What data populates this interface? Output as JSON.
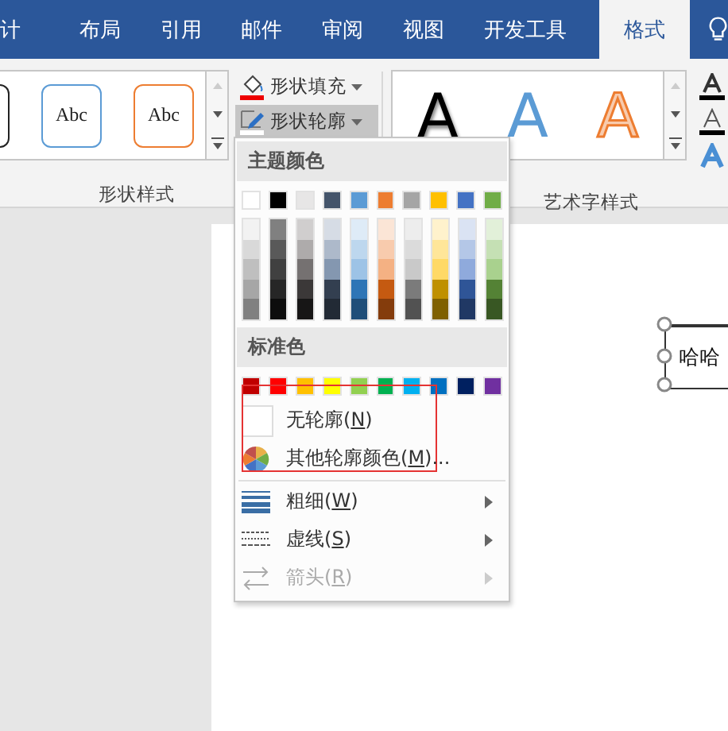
{
  "tabs": [
    {
      "label": "计",
      "selected": false
    },
    {
      "label": "布局",
      "selected": false
    },
    {
      "label": "引用",
      "selected": false
    },
    {
      "label": "邮件",
      "selected": false
    },
    {
      "label": "审阅",
      "selected": false
    },
    {
      "label": "视图",
      "selected": false
    },
    {
      "label": "开发工具",
      "selected": false
    },
    {
      "label": "格式",
      "selected": true
    }
  ],
  "shape_styles": {
    "thumbnails": [
      {
        "kind": "black"
      },
      {
        "kind": "blue",
        "text": "Abc"
      },
      {
        "kind": "orange",
        "text": "Abc"
      }
    ],
    "buttons": [
      {
        "kind": "fill",
        "label": "形状填充",
        "selected": false
      },
      {
        "kind": "outline",
        "label": "形状轮廓",
        "selected": true
      }
    ],
    "group_label": "形状样式"
  },
  "wordart_styles": {
    "letters": [
      {
        "kind": "black",
        "text": "A"
      },
      {
        "kind": "blue",
        "text": "A"
      },
      {
        "kind": "orange",
        "text": "A"
      }
    ],
    "group_label": "艺术字样式"
  },
  "outline_menu": {
    "theme_header": "主题颜色",
    "theme_colors": [
      {
        "color": "#ffffff"
      },
      {
        "color": "#000000"
      },
      {
        "color": "#e7e6e6"
      },
      {
        "color": "#44546a"
      },
      {
        "color": "#5b9bd5"
      },
      {
        "color": "#ed7d31"
      },
      {
        "color": "#a5a5a5"
      },
      {
        "color": "#ffc000"
      },
      {
        "color": "#4472c4"
      },
      {
        "color": "#70ad47"
      }
    ],
    "shades": [
      {
        "colors": [
          {
            "color": "#f2f2f2"
          },
          {
            "color": "#d9d9d9"
          },
          {
            "color": "#bfbfbf"
          },
          {
            "color": "#a6a6a6"
          },
          {
            "color": "#808080"
          }
        ]
      },
      {
        "colors": [
          {
            "color": "#808080"
          },
          {
            "color": "#595959"
          },
          {
            "color": "#404040"
          },
          {
            "color": "#262626"
          },
          {
            "color": "#0d0d0d"
          }
        ]
      },
      {
        "colors": [
          {
            "color": "#d0cece"
          },
          {
            "color": "#aeabab"
          },
          {
            "color": "#757171"
          },
          {
            "color": "#3b3838"
          },
          {
            "color": "#171616"
          }
        ]
      },
      {
        "colors": [
          {
            "color": "#d6dce5"
          },
          {
            "color": "#adb9ca"
          },
          {
            "color": "#8497b0"
          },
          {
            "color": "#333f50"
          },
          {
            "color": "#222a35"
          }
        ]
      },
      {
        "colors": [
          {
            "color": "#deebf7"
          },
          {
            "color": "#bdd7ee"
          },
          {
            "color": "#9dc3e6"
          },
          {
            "color": "#2e75b6"
          },
          {
            "color": "#1f4e79"
          }
        ]
      },
      {
        "colors": [
          {
            "color": "#fbe5d6"
          },
          {
            "color": "#f8cbad"
          },
          {
            "color": "#f4b183"
          },
          {
            "color": "#c55a11"
          },
          {
            "color": "#843c0c"
          }
        ]
      },
      {
        "colors": [
          {
            "color": "#ededed"
          },
          {
            "color": "#dbdbdb"
          },
          {
            "color": "#c9c9c9"
          },
          {
            "color": "#7b7b7b"
          },
          {
            "color": "#525252"
          }
        ]
      },
      {
        "colors": [
          {
            "color": "#fff2cc"
          },
          {
            "color": "#ffe699"
          },
          {
            "color": "#ffd966"
          },
          {
            "color": "#bf9000"
          },
          {
            "color": "#7f6000"
          }
        ]
      },
      {
        "colors": [
          {
            "color": "#dae3f3"
          },
          {
            "color": "#b4c7e7"
          },
          {
            "color": "#8faadc"
          },
          {
            "color": "#2f5597"
          },
          {
            "color": "#203864"
          }
        ]
      },
      {
        "colors": [
          {
            "color": "#e2f0d9"
          },
          {
            "color": "#c5e0b4"
          },
          {
            "color": "#a9d18e"
          },
          {
            "color": "#548235"
          },
          {
            "color": "#385723"
          }
        ]
      }
    ],
    "standard_header": "标准色",
    "standard_colors": [
      {
        "color": "#c00000"
      },
      {
        "color": "#ff0000"
      },
      {
        "color": "#ffc000"
      },
      {
        "color": "#ffff00"
      },
      {
        "color": "#92d050"
      },
      {
        "color": "#00b050"
      },
      {
        "color": "#00b0f0"
      },
      {
        "color": "#0070c0"
      },
      {
        "color": "#002060"
      },
      {
        "color": "#7030a0"
      }
    ],
    "items": [
      {
        "kind": "no-outline",
        "before": "无轮廓(",
        "key": "N",
        "after": ")",
        "submenu": false,
        "disabled": false
      },
      {
        "kind": "more-colors",
        "before": "其他轮廓颜色(",
        "key": "M",
        "after": ")...",
        "submenu": false,
        "disabled": false
      },
      {
        "kind": "weight",
        "before": "粗细(",
        "key": "W",
        "after": ")",
        "submenu": true,
        "disabled": false
      },
      {
        "kind": "dashes",
        "before": "虚线(",
        "key": "S",
        "after": ")",
        "submenu": true,
        "disabled": false
      },
      {
        "kind": "arrows",
        "before": "箭头(",
        "key": "R",
        "after": ")",
        "submenu": true,
        "disabled": true
      }
    ]
  },
  "document": {
    "text_box": "哈哈"
  }
}
